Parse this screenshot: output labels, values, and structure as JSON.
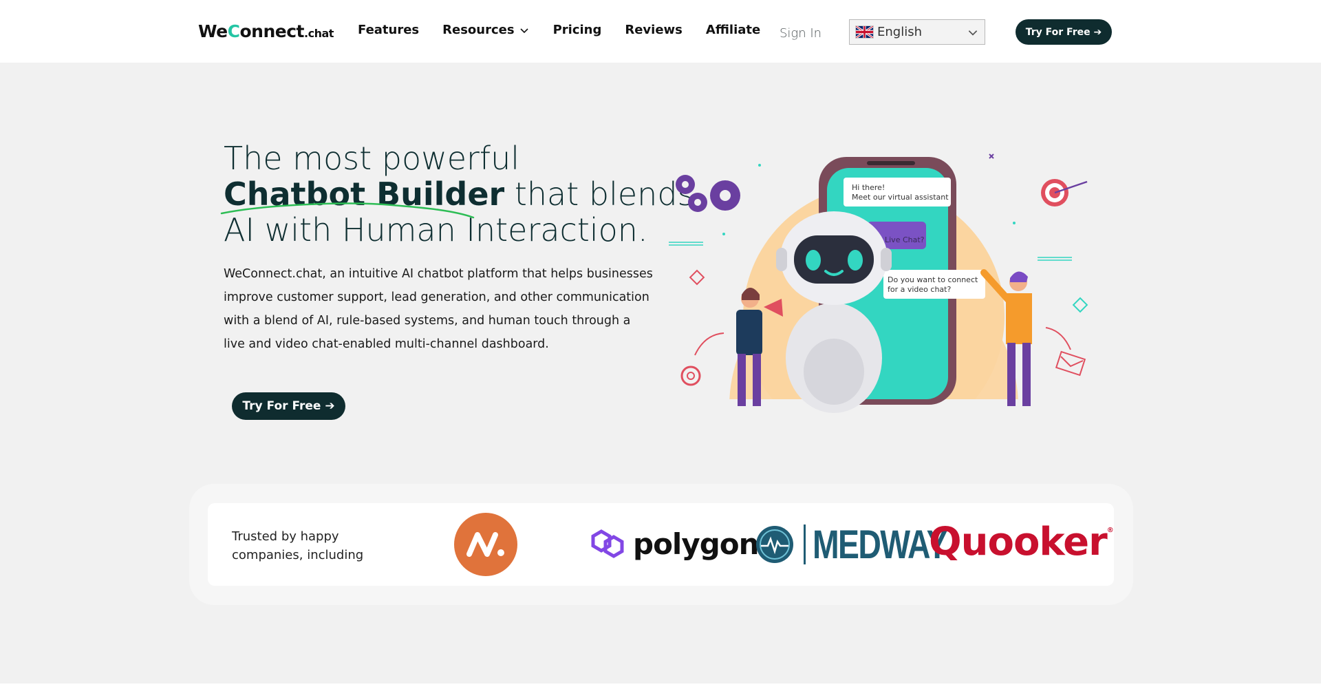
{
  "header": {
    "logo": {
      "we": "We",
      "c": "C",
      "rest": "onnect",
      "suffix": ".chat"
    },
    "nav": [
      {
        "label": "Features",
        "dropdown": false
      },
      {
        "label": "Resources",
        "dropdown": true
      },
      {
        "label": "Pricing",
        "dropdown": false
      },
      {
        "label": "Reviews",
        "dropdown": false
      },
      {
        "label": "Affiliate",
        "dropdown": false
      }
    ],
    "sign_in": "Sign In",
    "language": {
      "selected": "English",
      "flag": "uk-flag-icon"
    },
    "cta": "Try For Free ➔"
  },
  "hero": {
    "title_line1": "The most powerful",
    "title_bold": "Chatbot Builder",
    "title_line2_rest": " that blends",
    "title_line3": "AI with Human Interaction.",
    "description": "WeConnect.chat, an intuitive AI chatbot platform that helps businesses improve customer support, lead generation, and other communication with a blend of AI, rule-based systems, and human touch through a live and video chat-enabled multi-channel dashboard.",
    "cta": "Try For Free ➔"
  },
  "illustration": {
    "bubble1_line1": "Hi there!",
    "bubble1_line2": "Meet our virtual assistant",
    "bubble2": "Live Chat?",
    "bubble3_line1": "Do you want to connect",
    "bubble3_line2": "for a video chat?"
  },
  "trusted": {
    "text": "Trusted by happy companies, including",
    "logos": [
      {
        "name": "n-logo-icon"
      },
      {
        "name": "polygon",
        "text": "polygon"
      },
      {
        "name": "medway",
        "text": "MEDWAY"
      },
      {
        "name": "quooker",
        "text": "Quooker",
        "mark": "®"
      }
    ]
  },
  "colors": {
    "primary_dark": "#0f2c2f",
    "accent_teal": "#24c5a4",
    "polygon_purple": "#8247e5",
    "medway_blue": "#1f5c74",
    "quooker_red": "#c8102e",
    "n_logo_orange": "#e0733b"
  }
}
